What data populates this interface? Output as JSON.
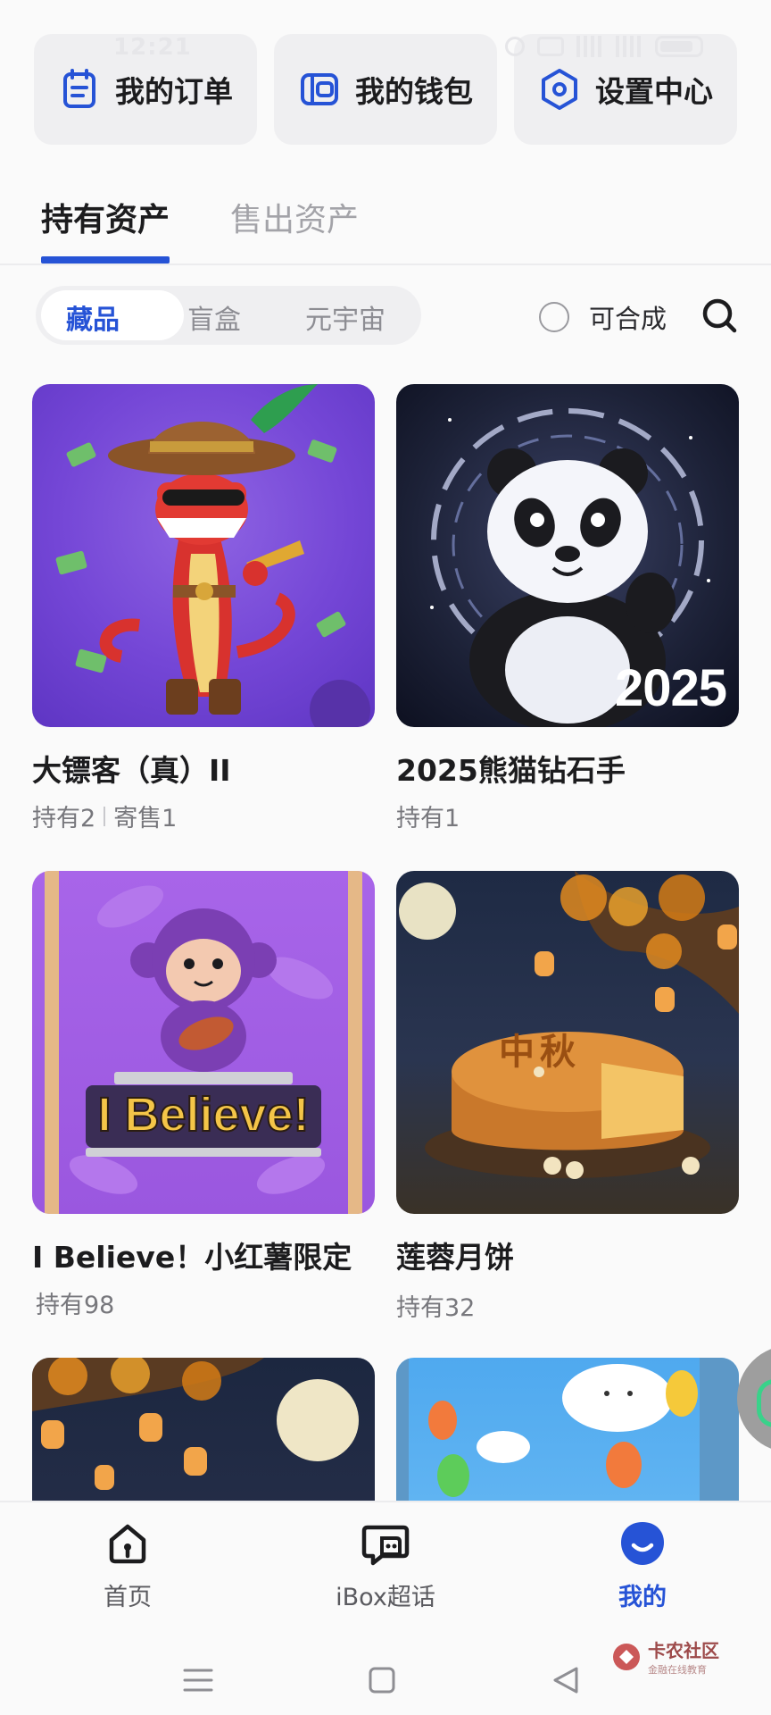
{
  "status_bar": {
    "time": "12:21"
  },
  "quick_actions": [
    {
      "label": "我的订单",
      "icon": "order-list-icon"
    },
    {
      "label": "我的钱包",
      "icon": "wallet-icon"
    },
    {
      "label": "设置中心",
      "icon": "settings-hex-icon"
    }
  ],
  "tabs": {
    "active": "持有资产",
    "inactive": "售出资产"
  },
  "segments": [
    "藏品",
    "盲盒",
    "元宇宙"
  ],
  "filter": {
    "label": "可合成",
    "checked": false
  },
  "assets": [
    {
      "name": "大镖客（真）II",
      "held": "持有2",
      "consign": "寄售1"
    },
    {
      "name": "2025熊猫钻石手",
      "held": "持有1",
      "image_text": "2025"
    },
    {
      "name": "I Believe！小红薯限定",
      "held": "持有98",
      "image_text": "I Believe!"
    },
    {
      "name": "莲蓉月饼",
      "held": "持有32",
      "image_text": "中秋"
    },
    {
      "name": "",
      "held": ""
    },
    {
      "name": "",
      "held": ""
    }
  ],
  "bottom_nav": [
    {
      "label": "首页",
      "icon": "home-icon"
    },
    {
      "label": "iBox超话",
      "icon": "chat-bubble-icon"
    },
    {
      "label": "我的",
      "icon": "profile-icon",
      "active": true
    }
  ],
  "watermark": {
    "title": "卡农社区",
    "subtitle": "金融在线教育"
  },
  "colors": {
    "accent": "#2653d6",
    "background": "#fafafa",
    "card": "#efeff1"
  }
}
